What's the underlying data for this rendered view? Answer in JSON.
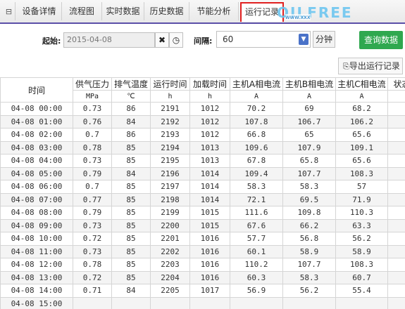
{
  "tabs": [
    {
      "label": "设备详情"
    },
    {
      "label": "流程图"
    },
    {
      "label": "实时数据"
    },
    {
      "label": "历史数据"
    },
    {
      "label": "节能分析"
    },
    {
      "label": "运行记录",
      "active": true
    }
  ],
  "logo": {
    "main": "OILFREE",
    "sub": "www.xxx"
  },
  "filter": {
    "start_label": "起始:",
    "start_value": "2015-04-08",
    "interval_label": "间隔:",
    "interval_value": "60",
    "unit_label": "分钟",
    "query_label": "查询数据",
    "export_label": "导出运行记录"
  },
  "table": {
    "headers": [
      "时间",
      "供气压力",
      "排气温度",
      "运行时间",
      "加载时间",
      "主机A相电流",
      "主机B相电流",
      "主机C相电流",
      "状态"
    ],
    "units": [
      "",
      "MPa",
      "℃",
      "h",
      "h",
      "A",
      "A",
      "A",
      ""
    ],
    "rows": [
      [
        "04-08 00:00",
        "0.73",
        "86",
        "2191",
        "1012",
        "70.2",
        "69",
        "68.2",
        ""
      ],
      [
        "04-08 01:00",
        "0.76",
        "84",
        "2192",
        "1012",
        "107.8",
        "106.7",
        "106.2",
        ""
      ],
      [
        "04-08 02:00",
        "0.7",
        "86",
        "2193",
        "1012",
        "66.8",
        "65",
        "65.6",
        ""
      ],
      [
        "04-08 03:00",
        "0.78",
        "85",
        "2194",
        "1013",
        "109.6",
        "107.9",
        "109.1",
        ""
      ],
      [
        "04-08 04:00",
        "0.73",
        "85",
        "2195",
        "1013",
        "67.8",
        "65.8",
        "65.6",
        ""
      ],
      [
        "04-08 05:00",
        "0.79",
        "84",
        "2196",
        "1014",
        "109.4",
        "107.7",
        "108.3",
        ""
      ],
      [
        "04-08 06:00",
        "0.7",
        "85",
        "2197",
        "1014",
        "58.3",
        "58.3",
        "57",
        ""
      ],
      [
        "04-08 07:00",
        "0.77",
        "85",
        "2198",
        "1014",
        "72.1",
        "69.5",
        "71.9",
        ""
      ],
      [
        "04-08 08:00",
        "0.79",
        "85",
        "2199",
        "1015",
        "111.6",
        "109.8",
        "110.3",
        ""
      ],
      [
        "04-08 09:00",
        "0.73",
        "85",
        "2200",
        "1015",
        "67.6",
        "66.2",
        "63.3",
        ""
      ],
      [
        "04-08 10:00",
        "0.72",
        "85",
        "2201",
        "1016",
        "57.7",
        "56.8",
        "56.2",
        ""
      ],
      [
        "04-08 11:00",
        "0.73",
        "85",
        "2202",
        "1016",
        "60.1",
        "58.9",
        "58.9",
        ""
      ],
      [
        "04-08 12:00",
        "0.78",
        "85",
        "2203",
        "1016",
        "110.2",
        "107.7",
        "108.3",
        ""
      ],
      [
        "04-08 13:00",
        "0.72",
        "85",
        "2204",
        "1016",
        "60.3",
        "58.3",
        "60.7",
        ""
      ],
      [
        "04-08 14:00",
        "0.71",
        "84",
        "2205",
        "1017",
        "56.9",
        "56.2",
        "55.4",
        ""
      ],
      [
        "04-08 15:00",
        "",
        "",
        "",
        "",
        "",
        "",
        "",
        ""
      ]
    ]
  },
  "colors": {
    "accent_underline": "#5b4fa8",
    "active_tab_border": "#e02020",
    "query_button": "#2fa84f",
    "select_arrow": "#4a72c8"
  }
}
